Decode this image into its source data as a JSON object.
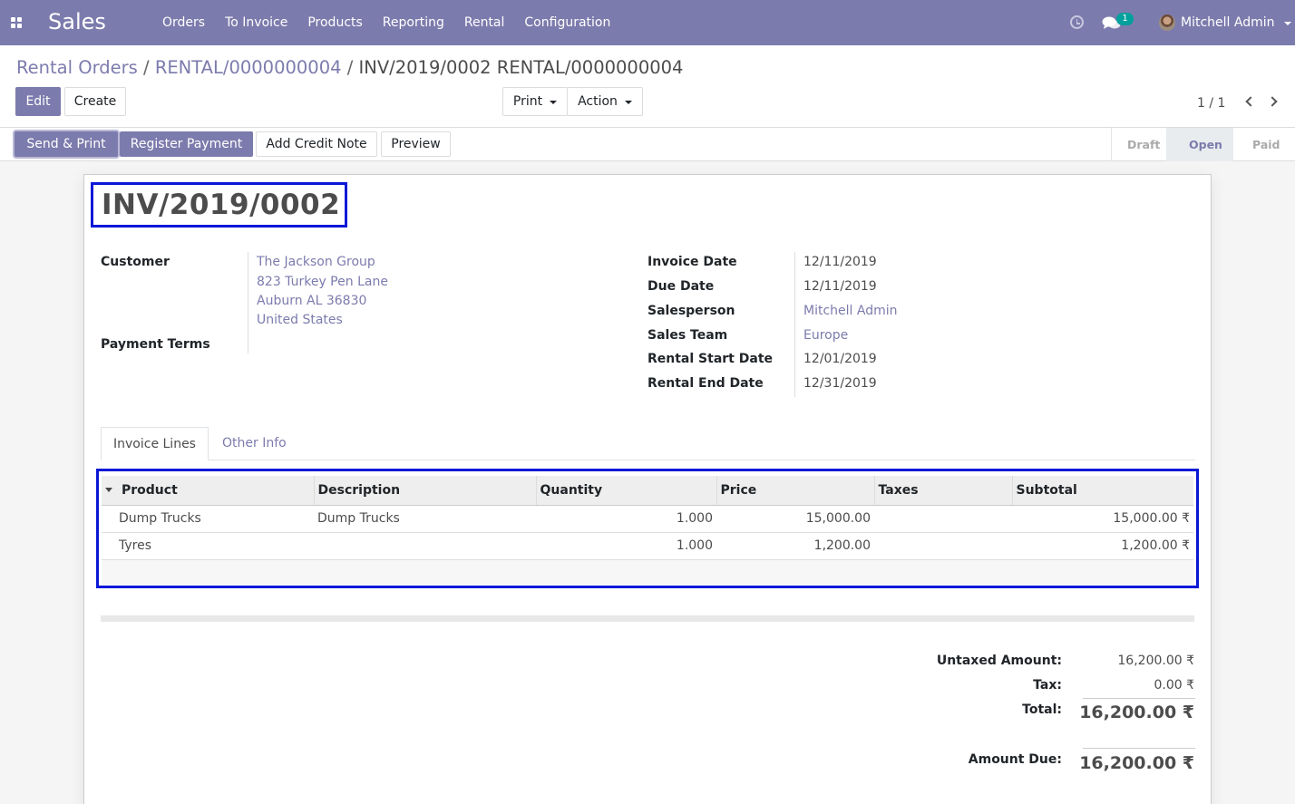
{
  "navbar": {
    "app_title": "Sales",
    "menu": [
      "Orders",
      "To Invoice",
      "Products",
      "Reporting",
      "Rental",
      "Configuration"
    ],
    "chat_count": "1",
    "user_name": "Mitchell Admin"
  },
  "breadcrumb": {
    "item1": "Rental Orders",
    "item2": "RENTAL/0000000004",
    "current": "INV/2019/0002 RENTAL/0000000004",
    "sep": "/"
  },
  "buttons": {
    "edit": "Edit",
    "create": "Create",
    "print": "Print",
    "action": "Action",
    "send_print": "Send & Print",
    "register_payment": "Register Payment",
    "add_credit_note": "Add Credit Note",
    "preview": "Preview"
  },
  "pager": {
    "value": "1 / 1"
  },
  "status": {
    "draft": "Draft",
    "open": "Open",
    "paid": "Paid"
  },
  "invoice": {
    "number": "INV/2019/0002",
    "customer_label": "Customer",
    "customer_name": "The Jackson Group",
    "address1": "823 Turkey Pen Lane",
    "address2": "Auburn AL 36830",
    "address3": "United States",
    "payment_terms_label": "Payment Terms",
    "fields": [
      {
        "label": "Invoice Date",
        "value": "12/11/2019"
      },
      {
        "label": "Due Date",
        "value": "12/11/2019"
      },
      {
        "label": "Salesperson",
        "value": "Mitchell Admin"
      },
      {
        "label": "Sales Team",
        "value": "Europe"
      },
      {
        "label": "Rental Start Date",
        "value": "12/01/2019"
      },
      {
        "label": "Rental End Date",
        "value": "12/31/2019"
      }
    ]
  },
  "tabs": {
    "invoice_lines": "Invoice Lines",
    "other_info": "Other Info"
  },
  "lines": {
    "headers": [
      "Product",
      "Description",
      "Quantity",
      "Price",
      "Taxes",
      "Subtotal"
    ],
    "rows": [
      {
        "product": "Dump Trucks",
        "description": "Dump Trucks",
        "quantity": "1.000",
        "price": "15,000.00",
        "taxes": "",
        "subtotal": "15,000.00 ₹"
      },
      {
        "product": "Tyres",
        "description": "",
        "quantity": "1.000",
        "price": "1,200.00",
        "taxes": "",
        "subtotal": "1,200.00 ₹"
      }
    ]
  },
  "totals": {
    "untaxed_label": "Untaxed Amount:",
    "untaxed_value": "16,200.00 ₹",
    "tax_label": "Tax:",
    "tax_value": "0.00 ₹",
    "total_label": "Total:",
    "total_value": "16,200.00 ₹",
    "amount_due_label": "Amount Due:",
    "amount_due_value": "16,200.00 ₹"
  },
  "colors": {
    "brand": "#7c7bad",
    "highlight": "#0a17d6"
  }
}
